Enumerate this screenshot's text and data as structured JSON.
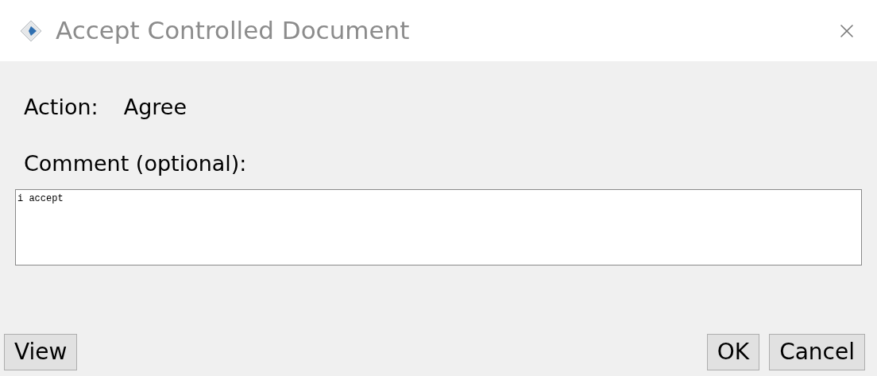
{
  "window": {
    "title": "Accept Controlled Document"
  },
  "action": {
    "label": "Action:",
    "value": "Agree"
  },
  "comment": {
    "label": "Comment (optional):",
    "value": "i accept"
  },
  "buttons_left": [
    "View"
  ],
  "buttons_right": [
    "OK",
    "Cancel"
  ]
}
